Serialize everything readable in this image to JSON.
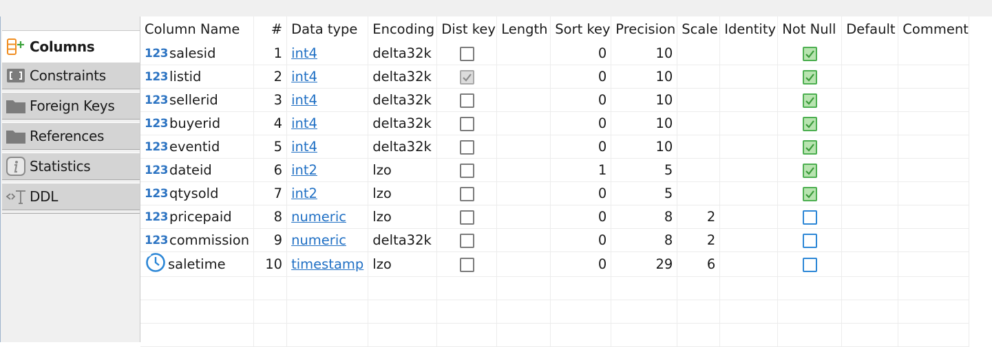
{
  "tabs": [
    {
      "label": "Columns",
      "icon": "columns-add-icon",
      "active": true
    },
    {
      "label": "Constraints",
      "icon": "constraints-icon",
      "active": false
    },
    {
      "label": "Foreign Keys",
      "icon": "folder-icon",
      "active": false
    },
    {
      "label": "References",
      "icon": "folder-icon",
      "active": false
    },
    {
      "label": "Statistics",
      "icon": "info-icon",
      "active": false
    },
    {
      "label": "DDL",
      "icon": "ddl-icon",
      "active": false
    }
  ],
  "grid": {
    "headers": {
      "name": "Column Name",
      "num": "#",
      "type": "Data type",
      "encoding": "Encoding",
      "distkey": "Dist key",
      "length": "Length",
      "sortkey": "Sort key",
      "precision": "Precision",
      "scale": "Scale",
      "identity": "Identity",
      "notnull": "Not Null",
      "default": "Default",
      "comment": "Comment"
    },
    "rows": [
      {
        "icon": "123",
        "name": "salesid",
        "num": "1",
        "type": "int4",
        "encoding": "delta32k",
        "distkey": "unchecked",
        "length": "",
        "sortkey": "0",
        "precision": "10",
        "scale": "",
        "identity": "",
        "notnull": "checked",
        "default": "",
        "comment": ""
      },
      {
        "icon": "123",
        "name": "listid",
        "num": "2",
        "type": "int4",
        "encoding": "delta32k",
        "distkey": "checked-disabled",
        "length": "",
        "sortkey": "0",
        "precision": "10",
        "scale": "",
        "identity": "",
        "notnull": "checked",
        "default": "",
        "comment": ""
      },
      {
        "icon": "123",
        "name": "sellerid",
        "num": "3",
        "type": "int4",
        "encoding": "delta32k",
        "distkey": "unchecked",
        "length": "",
        "sortkey": "0",
        "precision": "10",
        "scale": "",
        "identity": "",
        "notnull": "checked",
        "default": "",
        "comment": ""
      },
      {
        "icon": "123",
        "name": "buyerid",
        "num": "4",
        "type": "int4",
        "encoding": "delta32k",
        "distkey": "unchecked",
        "length": "",
        "sortkey": "0",
        "precision": "10",
        "scale": "",
        "identity": "",
        "notnull": "checked",
        "default": "",
        "comment": ""
      },
      {
        "icon": "123",
        "name": "eventid",
        "num": "5",
        "type": "int4",
        "encoding": "delta32k",
        "distkey": "unchecked",
        "length": "",
        "sortkey": "0",
        "precision": "10",
        "scale": "",
        "identity": "",
        "notnull": "checked",
        "default": "",
        "comment": ""
      },
      {
        "icon": "123",
        "name": "dateid",
        "num": "6",
        "type": "int2",
        "encoding": "lzo",
        "distkey": "unchecked",
        "length": "",
        "sortkey": "1",
        "precision": "5",
        "scale": "",
        "identity": "",
        "notnull": "checked",
        "default": "",
        "comment": ""
      },
      {
        "icon": "123",
        "name": "qtysold",
        "num": "7",
        "type": "int2",
        "encoding": "lzo",
        "distkey": "unchecked",
        "length": "",
        "sortkey": "0",
        "precision": "5",
        "scale": "",
        "identity": "",
        "notnull": "checked",
        "default": "",
        "comment": ""
      },
      {
        "icon": "123",
        "name": "pricepaid",
        "num": "8",
        "type": "numeric",
        "encoding": "lzo",
        "distkey": "unchecked",
        "length": "",
        "sortkey": "0",
        "precision": "8",
        "scale": "2",
        "identity": "",
        "notnull": "unchecked",
        "default": "",
        "comment": ""
      },
      {
        "icon": "123",
        "name": "commission",
        "num": "9",
        "type": "numeric",
        "encoding": "delta32k",
        "distkey": "unchecked",
        "length": "",
        "sortkey": "0",
        "precision": "8",
        "scale": "2",
        "identity": "",
        "notnull": "unchecked",
        "default": "",
        "comment": ""
      },
      {
        "icon": "clock",
        "name": "saletime",
        "num": "10",
        "type": "timestamp",
        "encoding": "lzo",
        "distkey": "unchecked",
        "length": "",
        "sortkey": "0",
        "precision": "29",
        "scale": "6",
        "identity": "",
        "notnull": "unchecked",
        "default": "",
        "comment": ""
      }
    ]
  },
  "colors": {
    "link": "#1f6fc4",
    "type_icon": "#2b73c2",
    "checked_green": "#4caf50",
    "notnull_unchecked": "#2b86d6",
    "columns_icon": "#f08c1e"
  }
}
